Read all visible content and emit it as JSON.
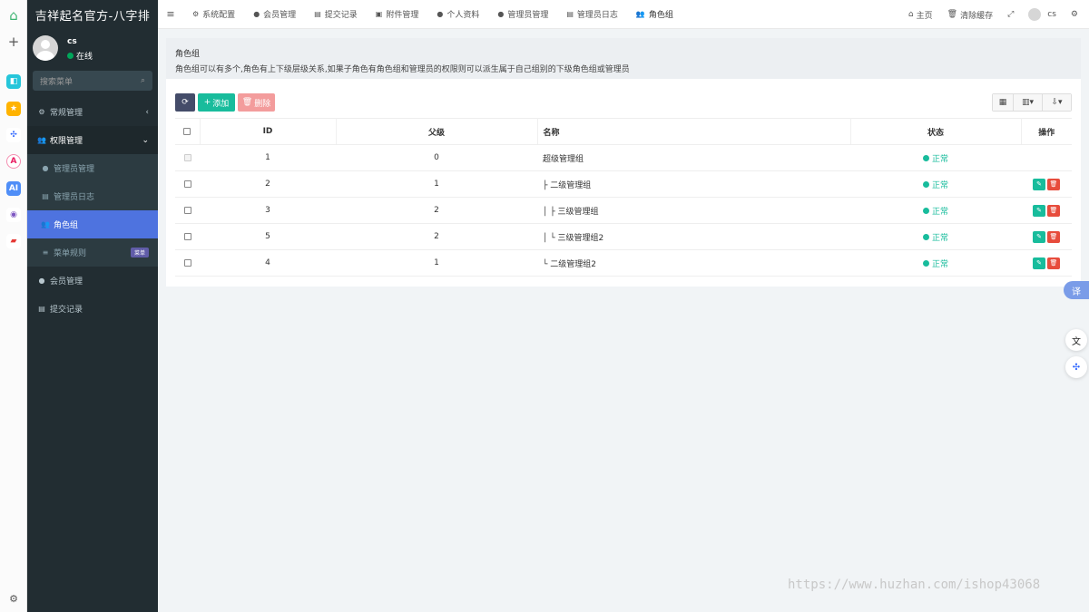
{
  "app": {
    "brand": "吉祥起名官方-八字排"
  },
  "user": {
    "name": "cs",
    "status": "在线"
  },
  "sidebar": {
    "search_placeholder": "搜索菜单",
    "items": [
      {
        "label": "常规管理"
      },
      {
        "label": "权限管理"
      },
      {
        "label": "管理员管理"
      },
      {
        "label": "管理员日志"
      },
      {
        "label": "角色组"
      },
      {
        "label": "菜单规则",
        "badge": "菜单"
      },
      {
        "label": "会员管理"
      },
      {
        "label": "提交记录"
      }
    ]
  },
  "navbar": {
    "tabs": [
      {
        "label": "系统配置"
      },
      {
        "label": "会员管理"
      },
      {
        "label": "提交记录"
      },
      {
        "label": "附件管理"
      },
      {
        "label": "个人资料"
      },
      {
        "label": "管理员管理"
      },
      {
        "label": "管理员日志"
      },
      {
        "label": "角色组"
      }
    ],
    "home": "主页",
    "clear_cache": "清除缓存",
    "username": "cs"
  },
  "panel": {
    "title": "角色组",
    "description": "角色组可以有多个,角色有上下级层级关系,如果子角色有角色组和管理员的权限则可以派生属于自己组别的下级角色组或管理员"
  },
  "toolbar": {
    "add": "添加",
    "delete": "删除"
  },
  "table": {
    "headers": {
      "id": "ID",
      "pid": "父级",
      "name": "名称",
      "status": "状态",
      "operate": "操作"
    },
    "rows": [
      {
        "id": "1",
        "pid": "0",
        "name": "超级管理组",
        "status": "正常"
      },
      {
        "id": "2",
        "pid": "1",
        "name": "├ 二级管理组",
        "status": "正常"
      },
      {
        "id": "3",
        "pid": "2",
        "name": "│ ├ 三级管理组",
        "status": "正常"
      },
      {
        "id": "5",
        "pid": "2",
        "name": "│ └ 三级管理组2",
        "status": "正常"
      },
      {
        "id": "4",
        "pid": "1",
        "name": "└ 二级管理组2",
        "status": "正常"
      }
    ]
  },
  "floating": {
    "translate": "译"
  },
  "watermark": "https://www.huzhan.com/ishop43068",
  "colors": {
    "primary": "#4e73df",
    "success": "#18bc9c",
    "danger": "#e74c3c",
    "sidebar": "#222d32"
  }
}
